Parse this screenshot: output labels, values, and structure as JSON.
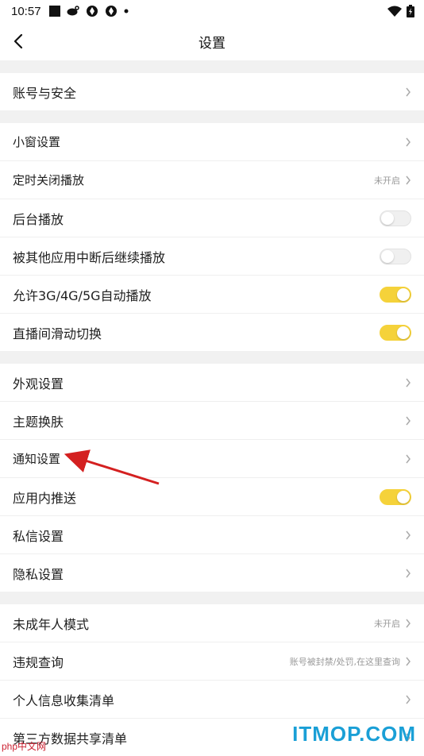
{
  "status_bar": {
    "time": "10:57",
    "icons": [
      "notification-square-icon",
      "weibo-icon",
      "app-icon",
      "app-icon",
      "dot-icon"
    ],
    "right_icons": [
      "wifi-icon",
      "battery-icon"
    ]
  },
  "header": {
    "title": "设置",
    "back_icon": "chevron-left-icon"
  },
  "groups": [
    {
      "rows": [
        {
          "label": "账号与安全",
          "type": "link"
        }
      ]
    },
    {
      "rows": [
        {
          "label": "小窗设置",
          "type": "link"
        },
        {
          "label": "定时关闭播放",
          "type": "link",
          "hint": "未开启"
        },
        {
          "label": "后台播放",
          "type": "toggle",
          "on": false
        },
        {
          "label": "被其他应用中断后继续播放",
          "type": "toggle",
          "on": false
        },
        {
          "label": "允许3G/4G/5G自动播放",
          "type": "toggle",
          "on": true
        },
        {
          "label": "直播间滑动切换",
          "type": "toggle",
          "on": true
        }
      ]
    },
    {
      "rows": [
        {
          "label": "外观设置",
          "type": "link"
        },
        {
          "label": "主题换肤",
          "type": "link"
        },
        {
          "label": "通知设置",
          "type": "link"
        },
        {
          "label": "应用内推送",
          "type": "toggle",
          "on": true
        },
        {
          "label": "私信设置",
          "type": "link"
        },
        {
          "label": "隐私设置",
          "type": "link"
        }
      ]
    },
    {
      "rows": [
        {
          "label": "未成年人模式",
          "type": "link",
          "hint": "未开启"
        },
        {
          "label": "违规查询",
          "type": "link",
          "hint": "账号被封禁/处罚,在这里查询"
        },
        {
          "label": "个人信息收集清单",
          "type": "link"
        },
        {
          "label": "第三方数据共享清单",
          "type": "link"
        }
      ]
    }
  ],
  "colors": {
    "toggle_on": "#f5d23a",
    "annotation_arrow": "#d42020",
    "watermark": "#1a9fd6"
  },
  "watermark": {
    "text": "ITMOP.COM",
    "corner_text": "php中文网"
  }
}
